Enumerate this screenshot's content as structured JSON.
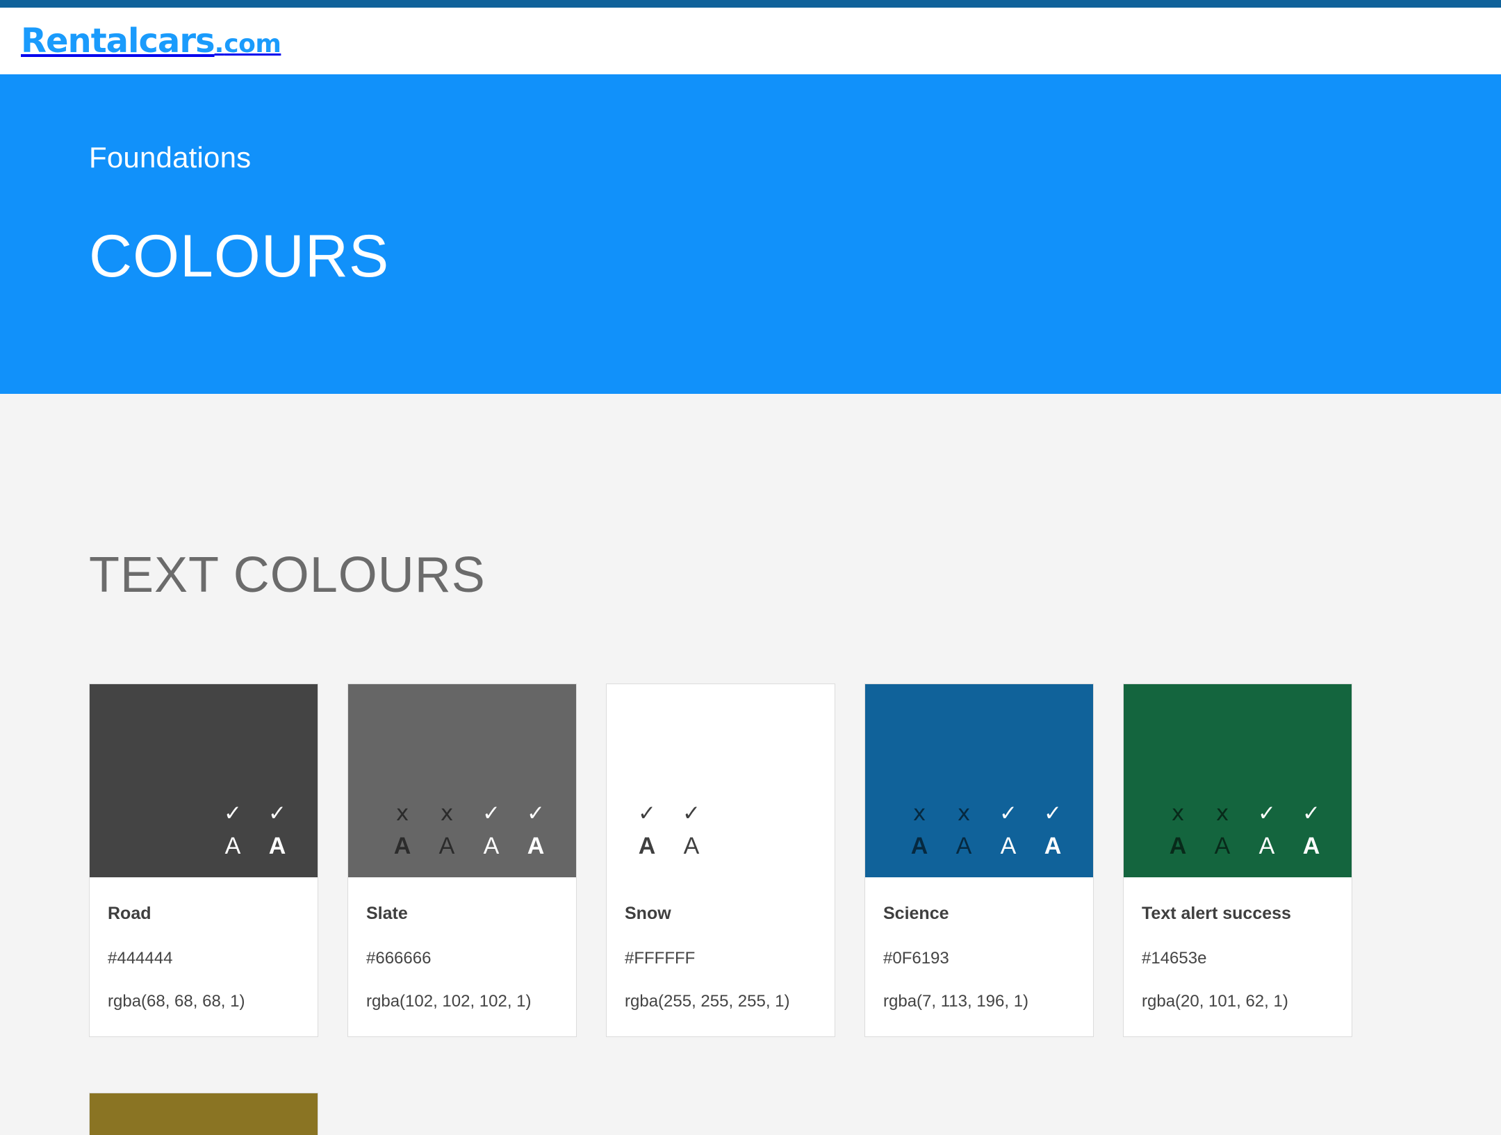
{
  "topbar": {
    "color": "#10629a"
  },
  "header": {
    "brand_main": "Rentalcars",
    "brand_dot": ".",
    "brand_tld": "com",
    "brand_color": "#1a9bfc"
  },
  "hero": {
    "eyebrow": "Foundations",
    "title": "COLOURS",
    "background": "#1191fa",
    "text_color": "#ffffff"
  },
  "sections": [
    {
      "title": "TEXT COLOURS",
      "swatches": [
        {
          "name": "Road",
          "hex": "#444444",
          "rgba": "rgba(68, 68, 68, 1)",
          "chip_color": "#444444",
          "align": "right",
          "contrast": [
            {
              "mark": "✓",
              "letter": "A",
              "weight": "normal",
              "state": "pass"
            },
            {
              "mark": "✓",
              "letter": "A",
              "weight": "bold",
              "state": "pass"
            }
          ]
        },
        {
          "name": "Slate",
          "hex": "#666666",
          "rgba": "rgba(102, 102, 102, 1)",
          "chip_color": "#666666",
          "align": "right",
          "contrast": [
            {
              "mark": "x",
              "letter": "A",
              "weight": "bold",
              "state": "fail"
            },
            {
              "mark": "x",
              "letter": "A",
              "weight": "normal",
              "state": "fail"
            },
            {
              "mark": "✓",
              "letter": "A",
              "weight": "normal",
              "state": "pass"
            },
            {
              "mark": "✓",
              "letter": "A",
              "weight": "bold",
              "state": "pass"
            }
          ]
        },
        {
          "name": "Snow",
          "hex": "#FFFFFF",
          "rgba": "rgba(255, 255, 255, 1)",
          "chip_color": "#FFFFFF",
          "align": "left",
          "contrast": [
            {
              "mark": "✓",
              "letter": "A",
              "weight": "bold",
              "state": "pass-dark"
            },
            {
              "mark": "✓",
              "letter": "A",
              "weight": "normal",
              "state": "pass-dark"
            }
          ]
        },
        {
          "name": "Science",
          "hex": "#0F6193",
          "rgba": "rgba(7, 113, 196, 1)",
          "chip_color": "#10629a",
          "align": "right",
          "contrast": [
            {
              "mark": "x",
              "letter": "A",
              "weight": "bold",
              "state": "fail"
            },
            {
              "mark": "x",
              "letter": "A",
              "weight": "normal",
              "state": "fail"
            },
            {
              "mark": "✓",
              "letter": "A",
              "weight": "normal",
              "state": "pass"
            },
            {
              "mark": "✓",
              "letter": "A",
              "weight": "bold",
              "state": "pass"
            }
          ]
        },
        {
          "name": "Text alert success",
          "hex": "#14653e",
          "rgba": "rgba(20, 101, 62, 1)",
          "chip_color": "#14653e",
          "align": "right",
          "contrast": [
            {
              "mark": "x",
              "letter": "A",
              "weight": "bold",
              "state": "fail"
            },
            {
              "mark": "x",
              "letter": "A",
              "weight": "normal",
              "state": "fail"
            },
            {
              "mark": "✓",
              "letter": "A",
              "weight": "normal",
              "state": "pass"
            },
            {
              "mark": "✓",
              "letter": "A",
              "weight": "bold",
              "state": "pass"
            }
          ]
        }
      ]
    }
  ],
  "next_row": {
    "swatches": [
      {
        "chip_color": "#8a7423"
      }
    ]
  }
}
